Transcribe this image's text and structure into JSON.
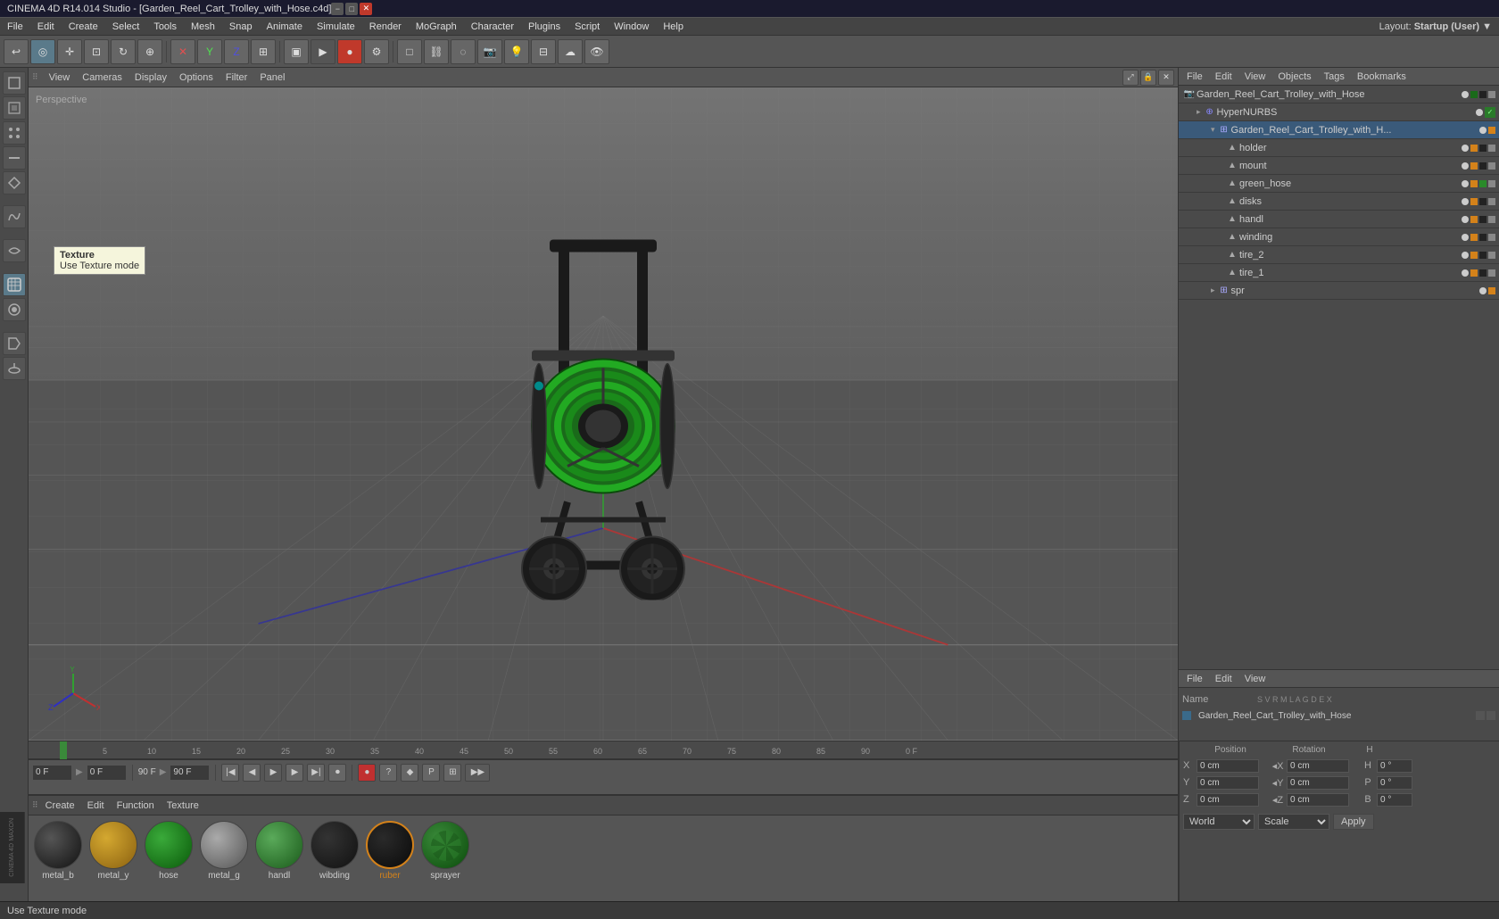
{
  "titlebar": {
    "title": "CINEMA 4D R14.014 Studio - [Garden_Reel_Cart_Trolley_with_Hose.c4d]",
    "minimize": "−",
    "maximize": "□",
    "close": "✕"
  },
  "menubar": {
    "items": [
      "File",
      "Edit",
      "Create",
      "Select",
      "Tools",
      "Mesh",
      "Snap",
      "Animate",
      "Simulate",
      "Render",
      "MoGraph",
      "Character",
      "Plugins",
      "Script",
      "Window",
      "Help"
    ],
    "layout_label": "Layout:",
    "layout_value": "Startup (User)"
  },
  "viewport": {
    "perspective": "Perspective",
    "menu_items": [
      "View",
      "Cameras",
      "Display",
      "Options",
      "Filter",
      "Panel"
    ],
    "tooltip_title": "Texture",
    "tooltip_subtitle": "Use Texture mode"
  },
  "scene_tree": {
    "header_items": [
      "File",
      "Edit",
      "View",
      "Objects",
      "Tags",
      "Bookmarks"
    ],
    "items": [
      {
        "id": "garden-reel",
        "label": "Garden_Reel_Cart_Trolley_with_Hose",
        "depth": 0,
        "type": "root",
        "icon": "📷"
      },
      {
        "id": "hyper-nurbs",
        "label": "HyperNURBS",
        "depth": 1,
        "type": "nurbs"
      },
      {
        "id": "garden-reel-2",
        "label": "Garden_Reel_Cart_Trolley_with_H...",
        "depth": 2,
        "type": "group",
        "selected": true
      },
      {
        "id": "holder",
        "label": "holder",
        "depth": 3,
        "type": "object"
      },
      {
        "id": "mount",
        "label": "mount",
        "depth": 3,
        "type": "object"
      },
      {
        "id": "green_hose",
        "label": "green_hose",
        "depth": 3,
        "type": "object"
      },
      {
        "id": "disks",
        "label": "disks",
        "depth": 3,
        "type": "object"
      },
      {
        "id": "handl",
        "label": "handl",
        "depth": 3,
        "type": "object"
      },
      {
        "id": "winding",
        "label": "winding",
        "depth": 3,
        "type": "object"
      },
      {
        "id": "tire_2",
        "label": "tire_2",
        "depth": 3,
        "type": "object"
      },
      {
        "id": "tire_1",
        "label": "tire_1",
        "depth": 3,
        "type": "object"
      },
      {
        "id": "spr",
        "label": "spr",
        "depth": 2,
        "type": "group"
      }
    ]
  },
  "attr_panel": {
    "header_items": [
      "File",
      "Edit",
      "View"
    ],
    "name_label": "Name",
    "columns": [
      "S",
      "V",
      "R",
      "M",
      "L",
      "A",
      "G",
      "D",
      "E",
      "X"
    ],
    "selected_name": "Garden_Reel_Cart_Trolley_with_Hose"
  },
  "timeline": {
    "frame_start": "0 F",
    "frame_end": "90 F",
    "current_frame": "0 F",
    "input_frame": "0 F",
    "ticks": [
      "0",
      "5",
      "10",
      "15",
      "20",
      "25",
      "30",
      "35",
      "40",
      "45",
      "50",
      "55",
      "60",
      "65",
      "70",
      "75",
      "80",
      "85",
      "90"
    ],
    "frame_display": "0 F",
    "end_frame_input": "90 F",
    "end_frame_display": "90 F"
  },
  "materials": {
    "menu_items": [
      "Create",
      "Edit",
      "Function",
      "Texture"
    ],
    "items": [
      {
        "id": "metal_b",
        "name": "metal_b",
        "color": "#1a1a1a",
        "type": "dark"
      },
      {
        "id": "metal_y",
        "name": "metal_y",
        "color": "#b8860b",
        "type": "yellow"
      },
      {
        "id": "hose",
        "name": "hose",
        "color": "#1a7a1a",
        "type": "green"
      },
      {
        "id": "metal_g",
        "name": "metal_g",
        "color": "#707070",
        "type": "gray"
      },
      {
        "id": "handl",
        "name": "handl",
        "color": "#2a5a2a",
        "type": "dark-green"
      },
      {
        "id": "wibding",
        "name": "wibding",
        "color": "#1a1a1a",
        "type": "dark"
      },
      {
        "id": "ruber",
        "name": "ruber",
        "color": "#222222",
        "type": "dark",
        "selected": true
      },
      {
        "id": "sprayer",
        "name": "sprayer",
        "color": "#2a5a2a",
        "type": "green-texture"
      }
    ]
  },
  "coordinates": {
    "x_label": "X",
    "y_label": "Y",
    "z_label": "Z",
    "x_val": "0 cm",
    "y_val": "0 cm",
    "z_val": "0 cm",
    "ex_val": "0 cm",
    "ey_val": "0 cm",
    "ez_val": "0 cm",
    "h_val": "0 °",
    "p_val": "0 °",
    "b_val": "0 °",
    "coord_label": "World",
    "scale_label": "Scale",
    "apply_label": "Apply"
  },
  "status_bar": {
    "text": "Use Texture mode"
  }
}
